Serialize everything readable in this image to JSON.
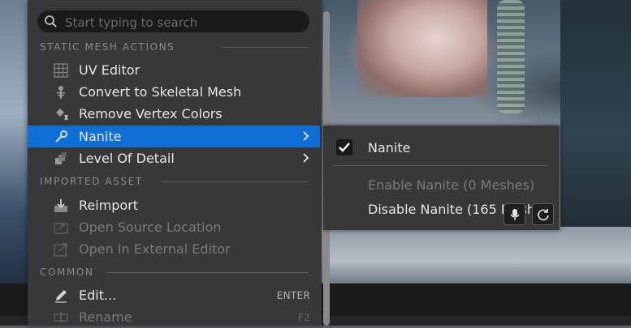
{
  "search": {
    "placeholder": "Start typing to search"
  },
  "sections": {
    "static_mesh_actions": "STATIC MESH ACTIONS",
    "imported_asset": "IMPORTED ASSET",
    "common": "COMMON"
  },
  "menu": {
    "items": [
      {
        "label": "UV Editor",
        "icon": "uv-grid-icon",
        "enabled": true
      },
      {
        "label": "Convert to Skeletal Mesh",
        "icon": "skeleton-icon",
        "enabled": true
      },
      {
        "label": "Remove Vertex Colors",
        "icon": "paint-bucket-remove-icon",
        "enabled": true
      },
      {
        "label": "Nanite",
        "icon": "wrench-icon",
        "enabled": true,
        "highlighted": true,
        "submenu": true
      },
      {
        "label": "Level Of Detail",
        "icon": "lod-icon",
        "enabled": true,
        "submenu": true
      },
      {
        "label": "Reimport",
        "icon": "reimport-icon",
        "enabled": true
      },
      {
        "label": "Open Source Location",
        "icon": "folder-open-icon",
        "enabled": false
      },
      {
        "label": "Open In External Editor",
        "icon": "external-editor-icon",
        "enabled": false
      },
      {
        "label": "Edit...",
        "icon": "pencil-icon",
        "enabled": true,
        "shortcut": "ENTER"
      },
      {
        "label": "Rename",
        "icon": "rename-icon",
        "enabled": false,
        "shortcut": "F2"
      }
    ]
  },
  "submenu": {
    "items": [
      {
        "label": "Nanite",
        "checked": true,
        "enabled": true
      },
      {
        "label": "Enable Nanite (0 Meshes)",
        "enabled": false
      },
      {
        "label": "Disable Nanite (165 Meshes)",
        "enabled": true
      }
    ]
  },
  "colors": {
    "menu_bg": "#383838",
    "highlight": "#0e6fd6",
    "text": "#e6e6e6",
    "disabled_text": "#7a7a7a",
    "section_text": "#8a8a8a"
  }
}
